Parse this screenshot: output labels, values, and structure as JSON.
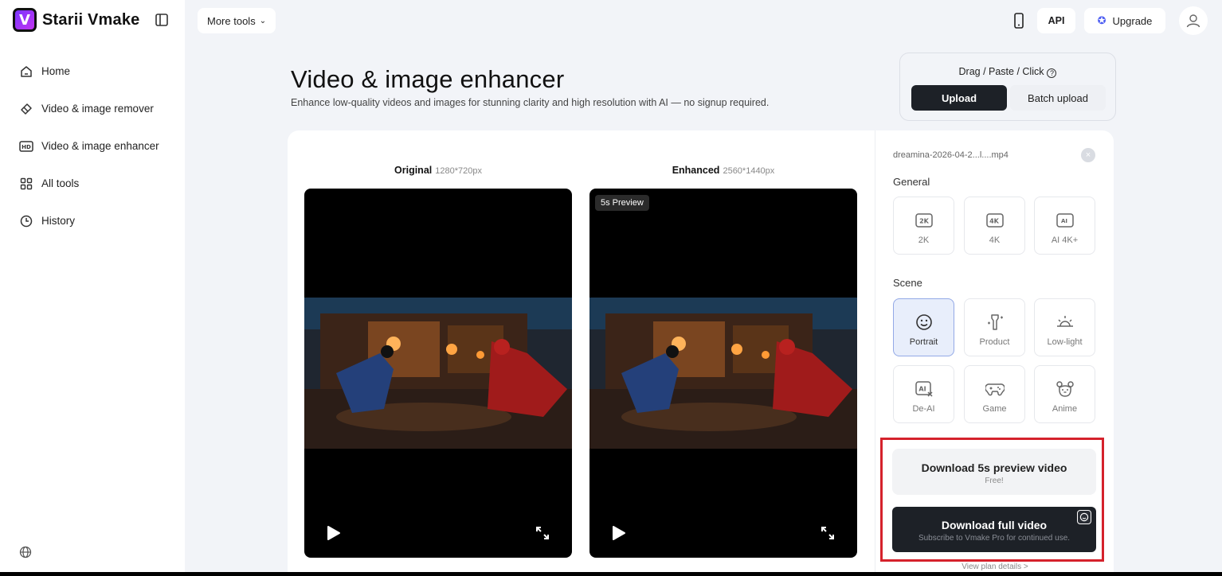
{
  "app": {
    "logo_letter": "V",
    "name": "Starii Vmake"
  },
  "sidebar": {
    "items": [
      {
        "label": "Home",
        "icon": "home-icon"
      },
      {
        "label": "Video & image remover",
        "icon": "eraser-icon"
      },
      {
        "label": "Video & image enhancer",
        "icon": "hd-icon"
      },
      {
        "label": "All tools",
        "icon": "grid-icon"
      },
      {
        "label": "History",
        "icon": "clock-icon"
      }
    ]
  },
  "topbar": {
    "more_tools": "More tools",
    "api": "API",
    "upgrade": "Upgrade"
  },
  "hero": {
    "title": "Video & image enhancer",
    "subtitle": "Enhance low-quality videos and images for stunning clarity and high resolution with AI — no signup required."
  },
  "upload": {
    "hint": "Drag / Paste / Click",
    "help": "?",
    "upload_label": "Upload",
    "batch_label": "Batch upload"
  },
  "compare": {
    "original_label": "Original",
    "original_dim": "1280*720px",
    "enhanced_label": "Enhanced",
    "enhanced_dim": "2560*1440px",
    "preview_badge": "5s Preview"
  },
  "panel": {
    "file_name": "dreamina-2026-04-2...l....mp4",
    "close": "×",
    "general_label": "General",
    "general": [
      {
        "label": "2K",
        "icon": "2k-icon"
      },
      {
        "label": "4K",
        "icon": "4k-icon"
      },
      {
        "label": "AI 4K+",
        "icon": "ai-4k-icon"
      }
    ],
    "scene_label": "Scene",
    "scene": [
      {
        "label": "Portrait",
        "icon": "smiley-icon",
        "active": true
      },
      {
        "label": "Product",
        "icon": "product-icon"
      },
      {
        "label": "Low-light",
        "icon": "sunrise-icon"
      },
      {
        "label": "De-AI",
        "icon": "de-ai-icon"
      },
      {
        "label": "Game",
        "icon": "gamepad-icon"
      },
      {
        "label": "Anime",
        "icon": "bear-icon"
      }
    ],
    "download_preview": {
      "title": "Download 5s preview video",
      "note": "Free!"
    },
    "download_full": {
      "title": "Download full video",
      "note": "Subscribe to Vmake Pro for continued use."
    },
    "plan_link": "View plan details >"
  },
  "colors": {
    "accent_dark": "#1d2127",
    "highlight_frame": "#d5222c",
    "active_bg": "#e8eefb"
  }
}
